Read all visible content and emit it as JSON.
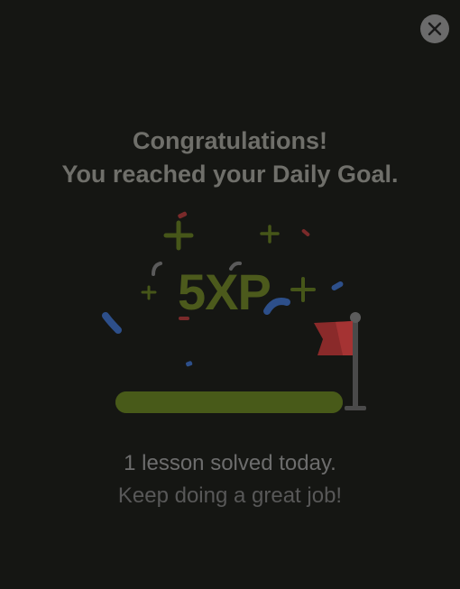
{
  "dialog": {
    "title_line1": "Congratulations!",
    "title_line2": "You reached your Daily Goal.",
    "xp_text": "5XP",
    "progress_fraction": 1.0,
    "summary_line1": "1 lesson solved today.",
    "summary_line2": "Keep doing a great job!"
  },
  "icons": {
    "close": "close-icon",
    "flag": "goal-flag-icon",
    "confetti": "confetti-icon",
    "sparkle": "plus-sparkle-icon"
  },
  "colors": {
    "background": "#151613",
    "accent_green": "#4c5a1c",
    "flag_red": "#8a2a2a",
    "confetti_blue": "#2d4f8a"
  }
}
